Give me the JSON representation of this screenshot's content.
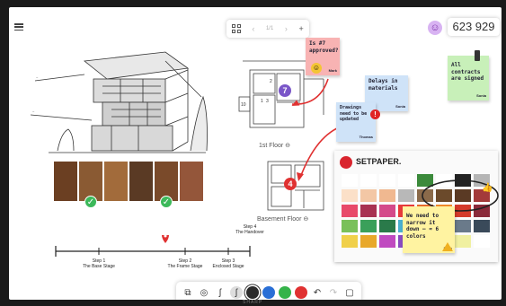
{
  "header": {
    "page_indicator": "1/1",
    "prev_label": "‹",
    "next_label": "›",
    "add_label": "+",
    "pin_symbol": "☺",
    "meeting_code": "623 929"
  },
  "floor_labels": {
    "first": "1st Floor",
    "basement": "Basement Floor"
  },
  "badges": {
    "plan_one": "7",
    "plan_two": "4"
  },
  "stickies": {
    "approval": {
      "text": "Is #7 approved?",
      "signature": "Mark",
      "color": "#f8b3b3"
    },
    "delays": {
      "text": "Delays in materials",
      "signature": "Sonia",
      "color": "#cfe3f8"
    },
    "drawings": {
      "text": "Drawings need to be updated",
      "signature": "Thomas",
      "color": "#cfe3f8"
    },
    "contracts": {
      "text": "All contracts are signed",
      "signature": "Sonia",
      "color": "#c8f0b9"
    },
    "narrow": {
      "text": "We need to narrow it down – ≈ 6 colors",
      "signature": "Mark",
      "color": "#fff3a1"
    }
  },
  "catalog": {
    "title": "SETPAPER."
  },
  "timeline": {
    "step1": {
      "title": "Step 1",
      "subtitle": "The Base Stage"
    },
    "step2": {
      "title": "Step 2",
      "subtitle": "The Frame Stage"
    },
    "step3": {
      "title": "Step 3",
      "subtitle": "Enclosed Stage"
    },
    "step4": {
      "title": "Step 4",
      "subtitle": "The Handover"
    }
  },
  "toolbar_colors": {
    "black": "#2a2a2a",
    "blue": "#2a6fd6",
    "green": "#35b34a",
    "red": "#e03131"
  },
  "brand_text": "SHARP",
  "icons": {
    "menu": "hamburger-menu-icon",
    "grid": "pages-grid-icon",
    "select": "select-icon",
    "shapes": "shapes-icon",
    "pen": "pen-icon",
    "highlighter": "highlighter-icon",
    "undo": "undo-icon",
    "redo": "redo-icon",
    "paste": "clipboard-icon"
  }
}
